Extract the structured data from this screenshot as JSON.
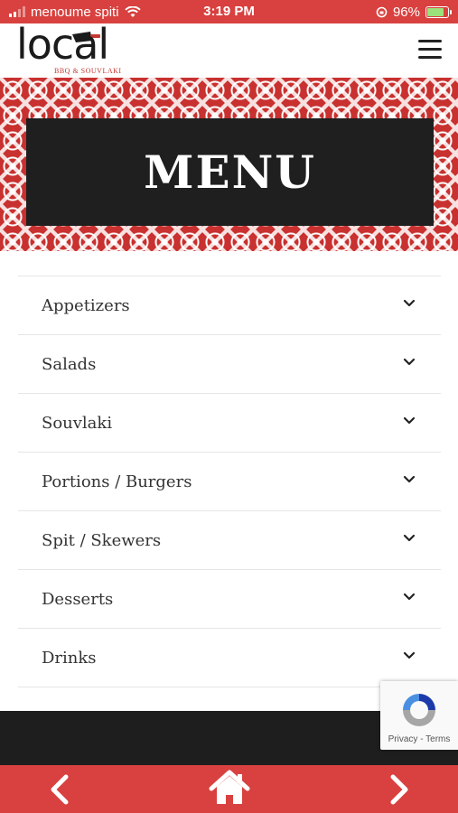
{
  "status_bar": {
    "carrier": "menoume spiti",
    "time": "3:19 PM",
    "battery": "96%",
    "battery_level": 0.96
  },
  "header": {
    "logo_text": "local",
    "logo_subtitle": "BBQ & SOUVLAKI",
    "menu_icon": "hamburger-icon"
  },
  "hero": {
    "title": "MENU"
  },
  "menu": {
    "items": [
      {
        "label": "Appetizers"
      },
      {
        "label": "Salads"
      },
      {
        "label": "Souvlaki"
      },
      {
        "label": "Portions / Burgers"
      },
      {
        "label": "Spit / Skewers"
      },
      {
        "label": "Desserts"
      },
      {
        "label": "Drinks"
      }
    ]
  },
  "recaptcha": {
    "links": "Privacy - Terms"
  },
  "bottom_nav": {
    "back_icon": "chevron-left-icon",
    "home_icon": "home-icon",
    "forward_icon": "chevron-right-icon"
  },
  "colors": {
    "brand_red": "#d8413f",
    "dark": "#1f1f1f"
  }
}
